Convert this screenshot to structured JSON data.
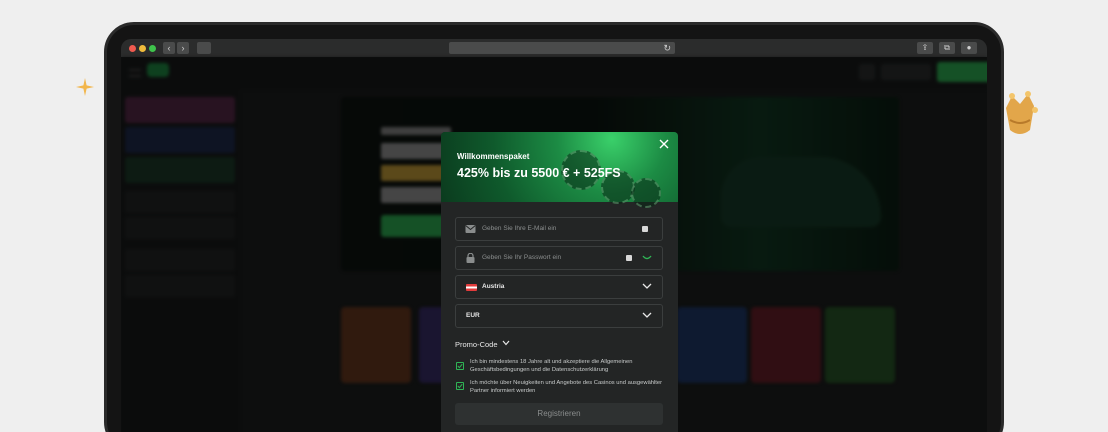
{
  "modal": {
    "subtitle": "Willkommenspaket",
    "title": "425% bis zu 5500 € + 525FS",
    "email_placeholder": "Geben Sie Ihre E-Mail ein",
    "password_placeholder": "Geben Sie Ihr Passwort ein",
    "country": "Austria",
    "currency": "EUR",
    "promo_label": "Promo-Code",
    "terms_text": "Ich bin mindestens 18 Jahre alt und akzeptiere die Allgemeinen Geschäftsbedingungen und die Datenschutzerklärung",
    "news_text": "Ich möchte über Neuigkeiten und Angebote des Casinos und ausgewählter Partner informiert werden",
    "register_label": "Registrieren",
    "terms_checked": true,
    "news_checked": true
  },
  "icons": {
    "close": "close-icon",
    "email": "mail-icon",
    "password": "lock-icon",
    "eye": "eye-icon",
    "flag": "austria-flag-icon",
    "chevron": "chevron-down-icon",
    "reload": "reload-icon"
  },
  "colors": {
    "accent": "#2fb455",
    "modal_bg": "#232525",
    "header_green": "#1c8b44",
    "frame": "#141414",
    "backdrop": "#efefef"
  }
}
